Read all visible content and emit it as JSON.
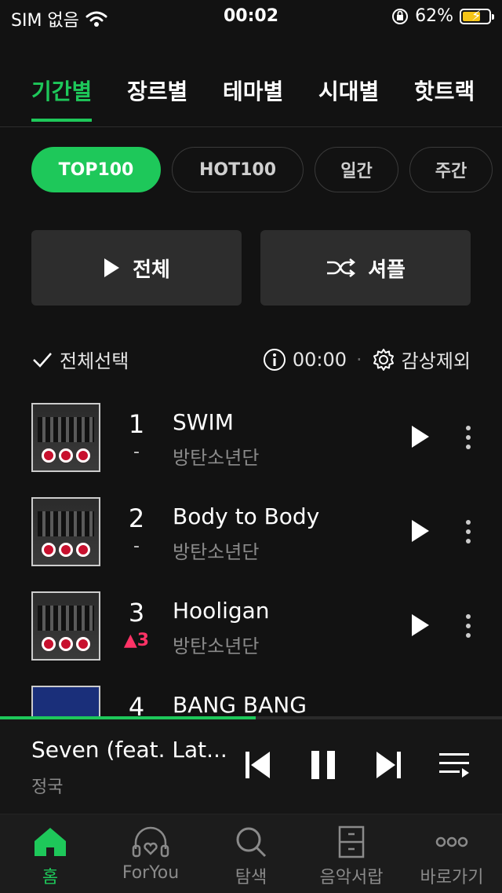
{
  "status": {
    "carrier": "SIM 없음",
    "time": "00:02",
    "battery": "62%"
  },
  "tabs": [
    {
      "label": "기간별",
      "active": true
    },
    {
      "label": "장르별"
    },
    {
      "label": "테마별"
    },
    {
      "label": "시대별"
    },
    {
      "label": "핫트랙"
    }
  ],
  "chips": [
    {
      "label": "TOP100",
      "active": true
    },
    {
      "label": "HOT100"
    },
    {
      "label": "일간"
    },
    {
      "label": "주간"
    }
  ],
  "actions": {
    "play_all": "전체",
    "shuffle": "셔플"
  },
  "toolbar": {
    "select_all": "전체선택",
    "timer": "00:00",
    "exclude": "감상제외"
  },
  "songs": [
    {
      "rank": "1",
      "change": "-",
      "title": "SWIM",
      "artist": "방탄소년단"
    },
    {
      "rank": "2",
      "change": "-",
      "title": "Body to Body",
      "artist": "방탄소년단"
    },
    {
      "rank": "3",
      "change": "▲3",
      "title": "Hooligan",
      "artist": "방탄소년단"
    },
    {
      "rank": "4",
      "change": "",
      "title": "BANG BANG",
      "artist": ""
    }
  ],
  "now_playing": {
    "title": "Seven (feat. Lat...",
    "artist": "정국",
    "progress": 0.51
  },
  "nav": [
    {
      "label": "홈",
      "icon": "home-icon",
      "active": true
    },
    {
      "label": "ForYou",
      "icon": "headphones-heart-icon"
    },
    {
      "label": "탐색",
      "icon": "search-icon"
    },
    {
      "label": "음악서랍",
      "icon": "drawer-icon"
    },
    {
      "label": "바로가기",
      "icon": "more-dots-icon"
    }
  ],
  "colors": {
    "accent": "#1ec85a",
    "rank_up": "#ff3366",
    "background": "#121212"
  }
}
